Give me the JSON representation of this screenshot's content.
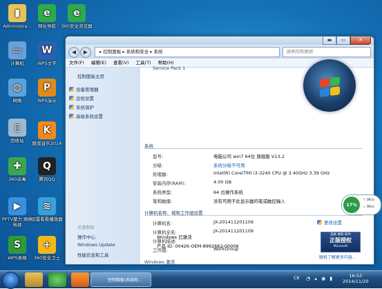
{
  "desktop_icons": [
    {
      "label": "Administra...",
      "color": "#e8c35a",
      "glyph": "▮"
    },
    {
      "label": "网址导航",
      "color": "#2eaa4a",
      "glyph": "e"
    },
    {
      "label": "360安全浏览器",
      "color": "#2eaa4a",
      "glyph": "e"
    },
    {
      "label": "计算机",
      "color": "#6aa0d6",
      "glyph": "▭"
    },
    {
      "label": "WPS文字",
      "color": "#2f5fb5",
      "glyph": "W"
    },
    {
      "label": "网络",
      "color": "#5ba2d8",
      "glyph": "◍"
    },
    {
      "label": "WPS演示",
      "color": "#e08a1c",
      "glyph": "P"
    },
    {
      "label": "回收站",
      "color": "#9fb8d0",
      "glyph": "▯"
    },
    {
      "label": "酷我音乐2014",
      "color": "#f28a1b",
      "glyph": "K"
    },
    {
      "label": "360杀毒",
      "color": "#3aa84a",
      "glyph": "✚"
    },
    {
      "label": "腾讯QQ",
      "color": "#222222",
      "glyph": "Q"
    },
    {
      "label": "PPTV聚力 网络电视",
      "color": "#3b8fe0",
      "glyph": "▶"
    },
    {
      "label": "迅雷看看播放器",
      "color": "#3aa0d8",
      "glyph": "≋"
    },
    {
      "label": "WPS表格",
      "color": "#2f9a3a",
      "glyph": "S"
    },
    {
      "label": "360安全卫士",
      "color": "#f0b81a",
      "glyph": "+"
    }
  ],
  "window": {
    "title_buttons": {
      "min": "▬",
      "max": "▭",
      "close": "✕"
    },
    "address": {
      "back": "◀",
      "forward": "▶",
      "path": "▸ 控制面板 ▸ 系统和安全 ▸ 系统",
      "search_placeholder": "搜索控制面板"
    },
    "menu": [
      "文件(F)",
      "编辑(E)",
      "查看(V)",
      "工具(T)",
      "帮助(H)"
    ],
    "left_pane": {
      "home": "控制面板主页",
      "links": [
        "设备管理器",
        "远程设置",
        "系统保护",
        "高级系统设置"
      ],
      "see_also_title": "另请参阅",
      "see_also": [
        "操作中心",
        "Windows Update",
        "性能信息和工具"
      ]
    },
    "main": {
      "top_text": "Service Pack 1",
      "system_section": "系统",
      "system_rows": [
        {
          "label": "型号:",
          "value": "电脑公司 win7 64位 旗舰版 V13.2"
        },
        {
          "label": "分级:",
          "value": "系统分级不可用"
        },
        {
          "label": "处理器:",
          "value": "Intel(R) Core(TM) i3-3240 CPU @ 3.40GHz   3.39 GHz"
        },
        {
          "label": "安装内存(RAM):",
          "value": "4.00 GB"
        },
        {
          "label": "系统类型:",
          "value": "64 位操作系统"
        },
        {
          "label": "笔和触摸:",
          "value": "没有可用于此显示器的笔或触控输入"
        }
      ],
      "computer_section": "计算机名称、域和工作组设置",
      "computer_rows": [
        {
          "label": "计算机名:",
          "value": "JX-201411201109"
        },
        {
          "label": "计算机全名:",
          "value": "JX-201411201109"
        },
        {
          "label": "计算机描述:",
          "value": ""
        },
        {
          "label": "工作组:",
          "value": "WorkGroup"
        }
      ],
      "change_settings": "更改设置",
      "activation_section": "Windows 激活",
      "activation_status": "Windows 已激活",
      "product_id": "产品 ID: 00426-OEM-8992662-00006",
      "badge_top": "选择 微软 软件",
      "badge_main": "正版授权",
      "badge_sub": "Microsoft",
      "more_info": "联机了解更多内容..."
    }
  },
  "network_widget": {
    "percent": "17%",
    "up": "0K/s",
    "down": "0K/s"
  },
  "taskbar": {
    "window_label": "控制面板\\系统和...",
    "tray_lang": "CK",
    "time": "16:53",
    "date": "2014/11/20"
  }
}
